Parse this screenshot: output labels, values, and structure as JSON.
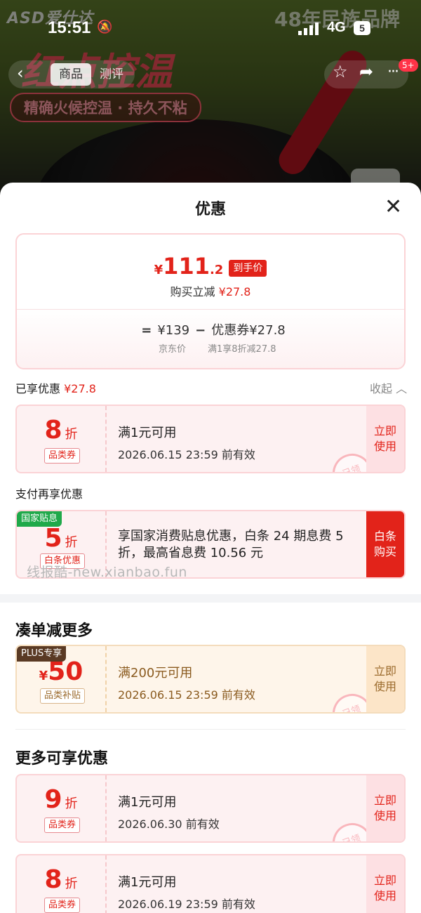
{
  "background": {
    "brand": "ASD爱仕达",
    "slogan": "48年民族品牌",
    "headline": "红点控温",
    "subhead": "精确火候控温 · 持久不粘"
  },
  "status": {
    "time": "15:51",
    "network": "4G",
    "battery": "5"
  },
  "nav": {
    "tabs": [
      "商品",
      "测评"
    ],
    "badge": "5+"
  },
  "sheet": {
    "title": "优惠",
    "summary": {
      "yen": "¥",
      "price_int": "111",
      "price_dec": ".2",
      "price_tag": "到手价",
      "reduce_label": "购买立减",
      "reduce_value": "¥27.8",
      "eq": "=",
      "jd_price": "¥139",
      "minus": "−",
      "coupon_part": "优惠券¥27.8",
      "jd_price_label": "京东价",
      "coupon_label": "满1享8折减27.8"
    },
    "enjoyed": {
      "label": "已享优惠",
      "value": "¥27.8",
      "collapse": "收起"
    },
    "pay_title": "支付再享优惠",
    "section_more": "凑单减更多",
    "section_extra": "更多可享优惠",
    "watermark": "线报酷-new.xianbao.fun",
    "coupons": [
      {
        "num": "8",
        "unit": "折",
        "chip": "品类券",
        "cond": "满1元可用",
        "valid": "2026.06.15 23:59 前有效",
        "action": "立即\n使用",
        "stamp": "已领"
      },
      {
        "corner": "国家贴息",
        "num": "5",
        "unit": "折",
        "chip": "白条优惠",
        "desc": "享国家消费贴息优惠，白条 24 期息费 5 折，最高省息费 10.56 元",
        "action": "白条\n购买"
      },
      {
        "corner": "PLUS专享",
        "yen": "¥",
        "num": "50",
        "chip": "品类补贴",
        "cond": "满200元可用",
        "valid": "2026.06.15 23:59 前有效",
        "action": "立即\n使用",
        "stamp": "已领"
      },
      {
        "num": "9",
        "unit": "折",
        "chip": "品类券",
        "cond": "满1元可用",
        "valid": "2026.06.30 前有效",
        "action": "立即\n使用",
        "stamp": "已领"
      },
      {
        "num": "8",
        "unit": "折",
        "chip": "品类券",
        "cond": "满1元可用",
        "valid": "2026.06.19 23:59 前有效",
        "action": "立即\n使用"
      }
    ]
  }
}
